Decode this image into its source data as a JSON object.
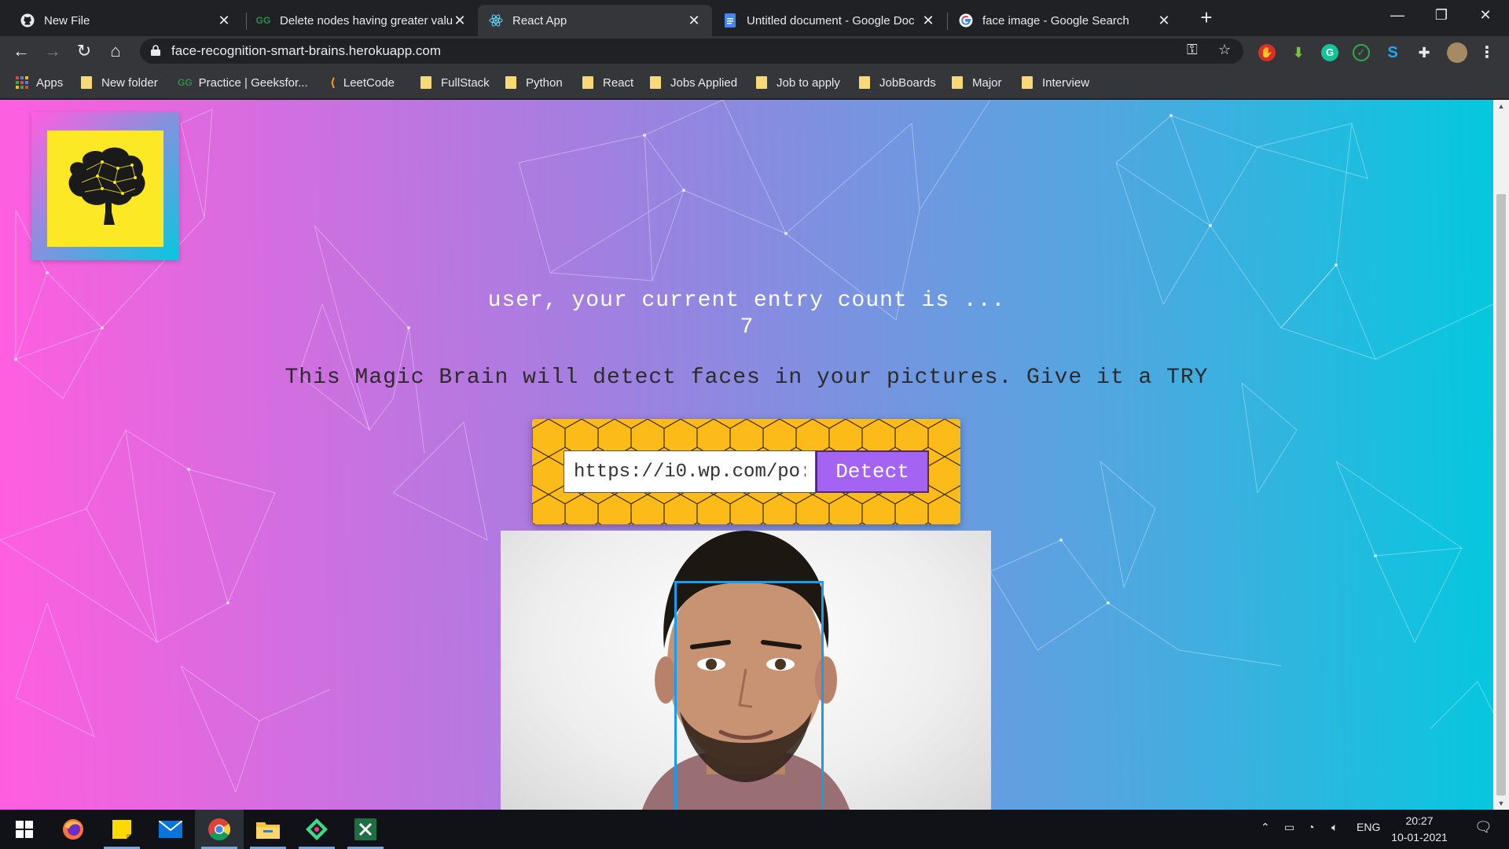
{
  "browser": {
    "tabs": [
      {
        "title": "New File",
        "favicon": "github-icon",
        "active": false
      },
      {
        "title": "Delete nodes having greater valu",
        "favicon": "geeksforgeeks-icon",
        "active": false
      },
      {
        "title": "React App",
        "favicon": "react-icon",
        "active": true
      },
      {
        "title": "Untitled document - Google Doc",
        "favicon": "google-docs-icon",
        "active": false
      },
      {
        "title": "face image - Google Search",
        "favicon": "google-icon",
        "active": false
      }
    ],
    "url": "face-recognition-smart-brains.herokuapp.com"
  },
  "bookmarks": [
    {
      "label": "Apps",
      "icon": "apps-grid-icon"
    },
    {
      "label": "New folder",
      "icon": "folder-icon"
    },
    {
      "label": "Practice | Geeksfor...",
      "icon": "geeksforgeeks-icon"
    },
    {
      "label": "LeetCode",
      "icon": "leetcode-icon"
    },
    {
      "label": "FullStack",
      "icon": "folder-icon"
    },
    {
      "label": "Python",
      "icon": "folder-icon"
    },
    {
      "label": "React",
      "icon": "folder-icon"
    },
    {
      "label": "Jobs Applied",
      "icon": "folder-icon"
    },
    {
      "label": "Job to apply",
      "icon": "folder-icon"
    },
    {
      "label": "JobBoards",
      "icon": "folder-icon"
    },
    {
      "label": "Major",
      "icon": "folder-icon"
    },
    {
      "label": "Interview",
      "icon": "folder-icon"
    }
  ],
  "page": {
    "entry_message": "user, your current entry count is ...",
    "entry_count": "7",
    "tagline": "This Magic Brain will detect faces in your pictures. Give it a TRY",
    "image_url_input": "https://i0.wp.com/po:",
    "detect_label": "Detect",
    "colors": {
      "gradient_start": "#ff5edf",
      "gradient_end": "#04c8de",
      "logo_bg": "#fde825",
      "button_bg": "#a463f2",
      "honeycomb": "#fdbb1a",
      "bounding_box": "#149df2"
    }
  },
  "taskbar": {
    "apps": [
      "windows-start-icon",
      "firefox-icon",
      "sticky-notes-icon",
      "mail-icon",
      "chrome-icon",
      "file-explorer-icon",
      "jetbrains-icon",
      "excel-icon"
    ],
    "language": "ENG",
    "time": "20:27",
    "date": "10-01-2021"
  }
}
